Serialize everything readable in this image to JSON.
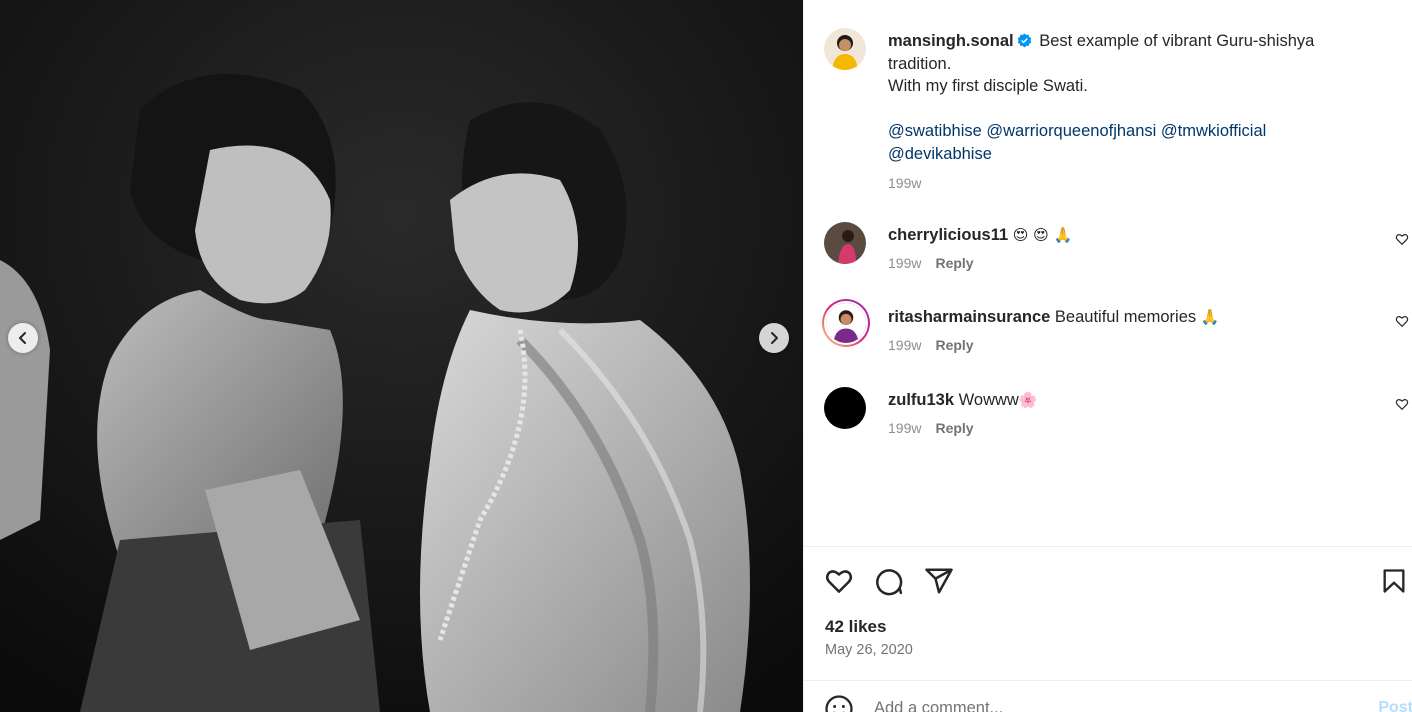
{
  "post": {
    "author": "mansingh.sonal",
    "caption_text": "Best example of vibrant Guru-shishya tradition.",
    "caption_line2": "With my first disciple Swati.",
    "mentions": [
      "@swatibhise",
      "@warriorqueenofjhansi",
      "@tmwkiofficial",
      "@devikabhise"
    ],
    "time": "199w"
  },
  "comments": [
    {
      "user": "cherrylicious11",
      "text": "",
      "emoji": "😍 😍 🙏",
      "time": "199w",
      "reply_label": "Reply"
    },
    {
      "user": "ritasharmainsurance",
      "text": "Beautiful memories",
      "emoji": "🙏",
      "time": "199w",
      "reply_label": "Reply"
    },
    {
      "user": "zulfu13k",
      "text": "Wowww",
      "emoji": "🌸",
      "time": "199w",
      "reply_label": "Reply"
    }
  ],
  "footer": {
    "likes": "42 likes",
    "date": "May 26, 2020",
    "comment_placeholder": "Add a comment...",
    "post_label": "Post"
  },
  "icons": {
    "verified": "verified-badge-icon",
    "like": "heart-icon",
    "comment": "comment-icon",
    "share": "share-icon",
    "save": "bookmark-icon",
    "prev": "chevron-left-icon",
    "next": "chevron-right-icon",
    "emoji": "emoji-smile-icon"
  },
  "colors": {
    "verified_blue": "#0095f6",
    "mention": "#00376b",
    "muted": "#737373"
  }
}
